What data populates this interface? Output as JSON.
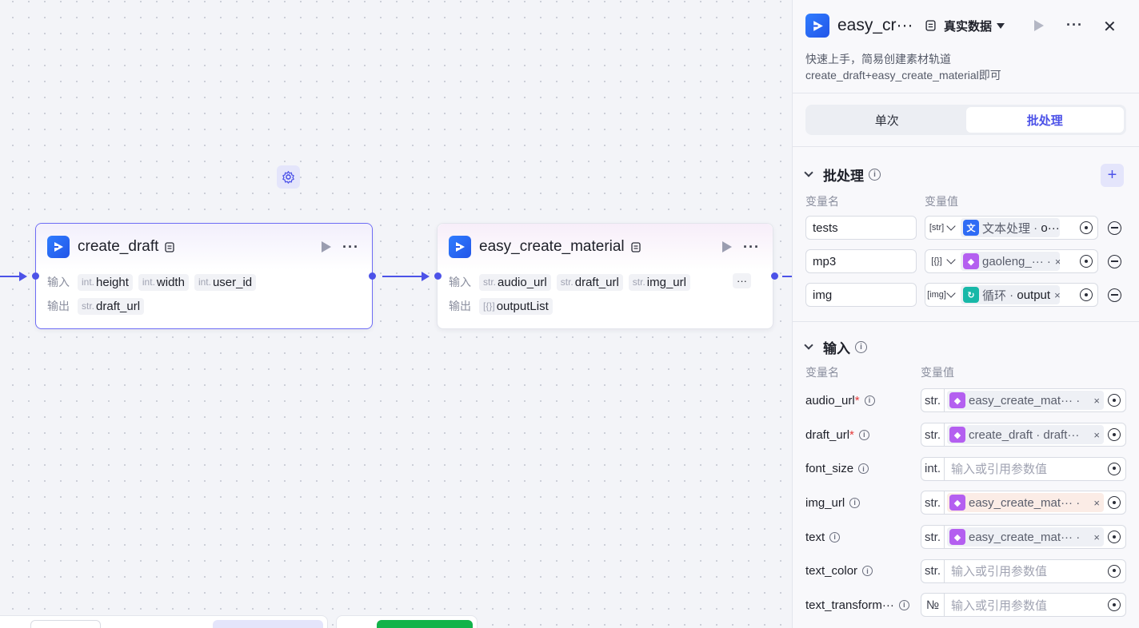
{
  "canvas": {
    "nodes": [
      {
        "title": "create_draft",
        "input_label": "输入",
        "output_label": "输出",
        "inputs": [
          {
            "type": "int.",
            "name": "height"
          },
          {
            "type": "int.",
            "name": "width"
          },
          {
            "type": "int.",
            "name": "user_id"
          }
        ],
        "outputs": [
          {
            "type": "str.",
            "name": "draft_url"
          }
        ]
      },
      {
        "title": "easy_create_material",
        "input_label": "输入",
        "output_label": "输出",
        "inputs": [
          {
            "type": "str.",
            "name": "audio_url"
          },
          {
            "type": "str.",
            "name": "draft_url"
          },
          {
            "type": "str.",
            "name": "img_url"
          }
        ],
        "more": "···",
        "outputs": [
          {
            "type": "[{}]",
            "name": "outputList"
          }
        ]
      }
    ]
  },
  "panel": {
    "title": "easy_cr···",
    "mode": "真实数据",
    "more": "···",
    "close": "✕",
    "description": "快速上手，简易创建素材轨道 create_draft+easy_create_material即可",
    "tabs": [
      {
        "label": "单次",
        "active": false
      },
      {
        "label": "批处理",
        "active": true
      }
    ],
    "batch": {
      "title": "批处理",
      "col_name": "变量名",
      "col_value": "变量值",
      "rows": [
        {
          "name": "tests",
          "type": "[str]",
          "node": "文本处理",
          "field": "o···",
          "icon_color": "#2f6cf5",
          "icon_glyph": "文"
        },
        {
          "name": "mp3",
          "type": "[{}]",
          "node": "gaoleng_···",
          "field": "",
          "icon_color": "#b45ff0",
          "icon_glyph": "◆"
        },
        {
          "name": "img",
          "type": "[img]",
          "node": "循环",
          "field": "output",
          "icon_color": "#18b8a8",
          "icon_glyph": "↻"
        }
      ]
    },
    "inputs": {
      "title": "输入",
      "col_name": "变量名",
      "col_value": "变量值",
      "rows": [
        {
          "name": "audio_url",
          "required": true,
          "type": "str.",
          "ref": "easy_create_mat··· ·",
          "placeholder": "",
          "warn": false
        },
        {
          "name": "draft_url",
          "required": true,
          "type": "str.",
          "ref": "create_draft · draft···",
          "placeholder": "",
          "warn": false
        },
        {
          "name": "font_size",
          "required": false,
          "type": "int.",
          "ref": "",
          "placeholder": "输入或引用参数值",
          "warn": false
        },
        {
          "name": "img_url",
          "required": false,
          "type": "str.",
          "ref": "easy_create_mat··· ·",
          "placeholder": "",
          "warn": true
        },
        {
          "name": "text",
          "required": false,
          "type": "str.",
          "ref": "easy_create_mat··· ·",
          "placeholder": "",
          "warn": false
        },
        {
          "name": "text_color",
          "required": false,
          "type": "str.",
          "ref": "",
          "placeholder": "输入或引用参数值",
          "warn": false
        },
        {
          "name": "text_transform···",
          "required": false,
          "type": "№",
          "ref": "",
          "placeholder": "输入或引用参数值",
          "warn": false
        }
      ]
    }
  },
  "colors": {
    "accent": "#4c52e8",
    "brand_blue": "#2f7dff",
    "green_button": "#12b34a",
    "purple_node": "#b45ff0"
  }
}
